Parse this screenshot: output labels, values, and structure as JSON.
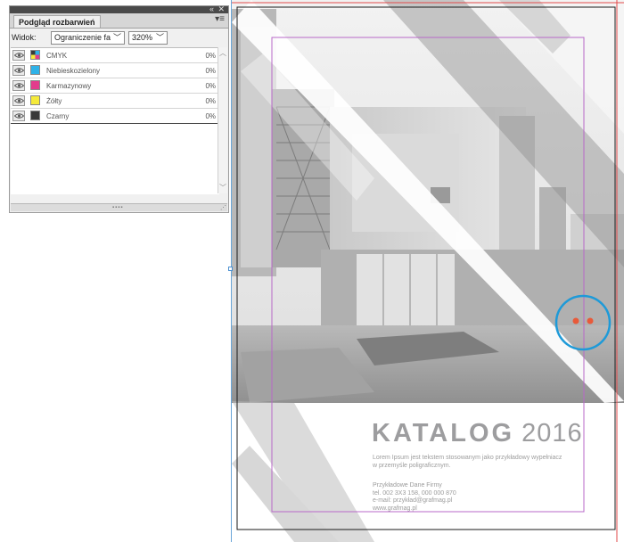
{
  "panel": {
    "title": "Podgląd rozbarwień",
    "collapse_icon": "double-chevron-left-icon",
    "close_icon": "close-icon",
    "menu_icon": "panel-menu-icon",
    "view_label": "Widok:",
    "view_value": "Ograniczenie fa",
    "zoom_value": "320%",
    "separations": [
      {
        "name": "CMYK",
        "percent": "0%",
        "color": "cmyk"
      },
      {
        "name": "Niebieskozielony",
        "percent": "0%",
        "color": "#2fb2e8"
      },
      {
        "name": "Karmazynowy",
        "percent": "0%",
        "color": "#e23c8c"
      },
      {
        "name": "Żółty",
        "percent": "0%",
        "color": "#f5ea3a"
      },
      {
        "name": "Czarny",
        "percent": "0%",
        "color": "#3a3a3a"
      }
    ]
  },
  "document": {
    "title_bold": "KATALOG",
    "title_year": "2016",
    "description_line1": "Lorem Ipsum jest tekstem stosowanym jako przykładowy wypełniacz",
    "description_line2": "w przemyśle poligraficznym.",
    "contact": [
      "Przykładowe Dane Firmy",
      "tel. 002 3X3 158, 000 000 870",
      "e-mail: przykład@grafmag.pl",
      "www.grafmag.pl"
    ],
    "colors": {
      "trim_box": "#1a1a1a",
      "margin_guides": "#b868c8",
      "bleed_guides": "#e24a4a",
      "frame_edge": "#6aa6d8",
      "highlight_circle": "#1e9ad8",
      "out_of_gamut_marks": "#e85a3a"
    }
  }
}
